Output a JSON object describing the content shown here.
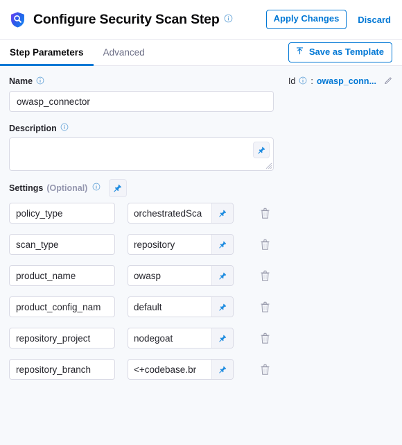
{
  "header": {
    "icon": "security-shield-scan-icon",
    "title": "Configure Security Scan Step",
    "info_icon": "info-icon",
    "apply_label": "Apply Changes",
    "discard_label": "Discard"
  },
  "tabs": [
    {
      "label": "Step Parameters",
      "active": true
    },
    {
      "label": "Advanced",
      "active": false
    }
  ],
  "toolbar": {
    "save_template_label": "Save as Template",
    "save_template_icon": "upload-icon"
  },
  "form": {
    "name": {
      "label": "Name",
      "value": "owasp_connector",
      "placeholder": ""
    },
    "id": {
      "label": "Id",
      "separator": ":",
      "value": "owasp_conn...",
      "edit_icon": "pencil-icon"
    },
    "description": {
      "label": "Description",
      "value": "",
      "placeholder": "",
      "pin_icon": "pin-icon"
    },
    "settings": {
      "label": "Settings",
      "optional_label": "(Optional)",
      "pin_icon": "pin-icon",
      "rows": [
        {
          "key": "policy_type",
          "value": "orchestratedSca"
        },
        {
          "key": "scan_type",
          "value": "repository"
        },
        {
          "key": "product_name",
          "value": "owasp"
        },
        {
          "key": "product_config_nam",
          "value": "default"
        },
        {
          "key": "repository_project",
          "value": "nodegoat"
        },
        {
          "key": "repository_branch",
          "value": "<+codebase.br"
        }
      ],
      "delete_icon": "trash-icon"
    }
  },
  "colors": {
    "accent": "#0278d5",
    "text": "#26262d",
    "muted": "#9496ae",
    "page_bg": "#f7f9fc",
    "border": "#d9dae5"
  }
}
